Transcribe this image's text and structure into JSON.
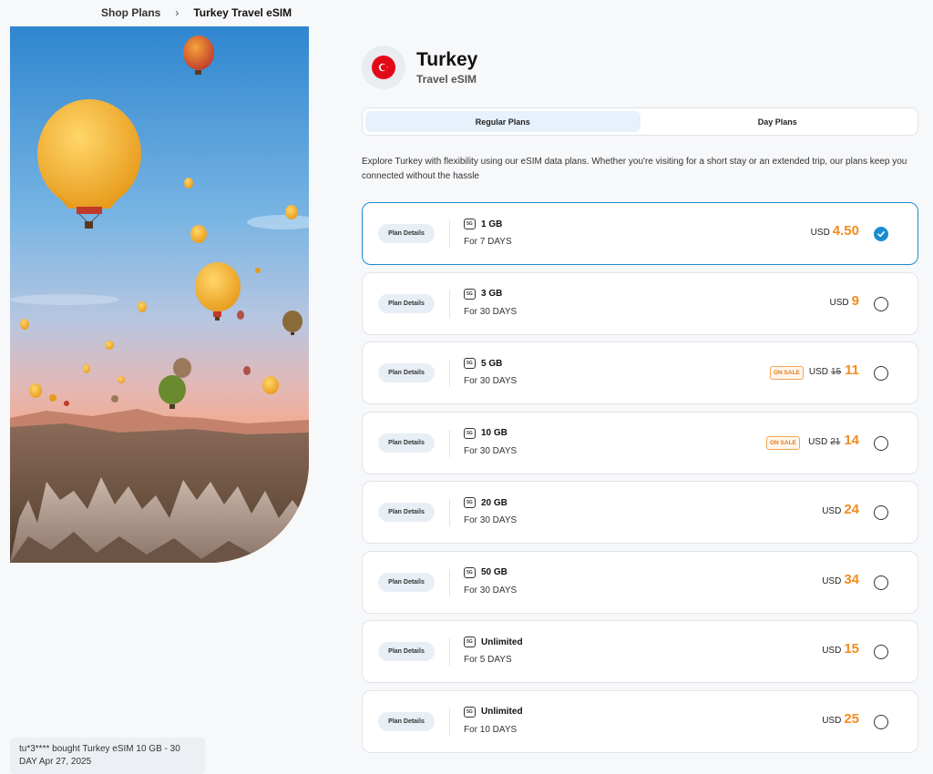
{
  "breadcrumb": {
    "parent": "Shop Plans",
    "separator": "›",
    "current": "Turkey Travel eSIM"
  },
  "header": {
    "country": "Turkey",
    "subtitle": "Travel eSIM"
  },
  "tabs": [
    {
      "label": "Regular Plans",
      "active": true
    },
    {
      "label": "Day Plans",
      "active": false
    }
  ],
  "description": "Explore Turkey with flexibility using our eSIM data plans. Whether you're visiting for a short stay or an extended trip, our plans keep you connected without the hassle",
  "plans": [
    {
      "details_label": "Plan Details",
      "network": "5G",
      "data": "1 GB",
      "duration": "For 7 DAYS",
      "currency": "USD",
      "old_price": "",
      "price": "4.50",
      "sale": "",
      "selected": true
    },
    {
      "details_label": "Plan Details",
      "network": "5G",
      "data": "3 GB",
      "duration": "For 30 DAYS",
      "currency": "USD",
      "old_price": "",
      "price": "9",
      "sale": "",
      "selected": false
    },
    {
      "details_label": "Plan Details",
      "network": "5G",
      "data": "5 GB",
      "duration": "For 30 DAYS",
      "currency": "USD",
      "old_price": "15",
      "price": "11",
      "sale": "ON SALE",
      "selected": false
    },
    {
      "details_label": "Plan Details",
      "network": "5G",
      "data": "10 GB",
      "duration": "For 30 DAYS",
      "currency": "USD",
      "old_price": "21",
      "price": "14",
      "sale": "ON SALE",
      "selected": false
    },
    {
      "details_label": "Plan Details",
      "network": "5G",
      "data": "20 GB",
      "duration": "For 30 DAYS",
      "currency": "USD",
      "old_price": "",
      "price": "24",
      "sale": "",
      "selected": false
    },
    {
      "details_label": "Plan Details",
      "network": "5G",
      "data": "50 GB",
      "duration": "For 30 DAYS",
      "currency": "USD",
      "old_price": "",
      "price": "34",
      "sale": "",
      "selected": false
    },
    {
      "details_label": "Plan Details",
      "network": "5G",
      "data": "Unlimited",
      "duration": "For 5 DAYS",
      "currency": "USD",
      "old_price": "",
      "price": "15",
      "sale": "",
      "selected": false
    },
    {
      "details_label": "Plan Details",
      "network": "5G",
      "data": "Unlimited",
      "duration": "For 10 DAYS",
      "currency": "USD",
      "old_price": "",
      "price": "25",
      "sale": "",
      "selected": false
    }
  ],
  "toast": "tu*3**** bought Turkey eSIM 10 GB - 30 DAY Apr 27, 2025",
  "colors": {
    "accent": "#1b8ccf",
    "price": "#f28c22",
    "flag": "#e30a17"
  }
}
